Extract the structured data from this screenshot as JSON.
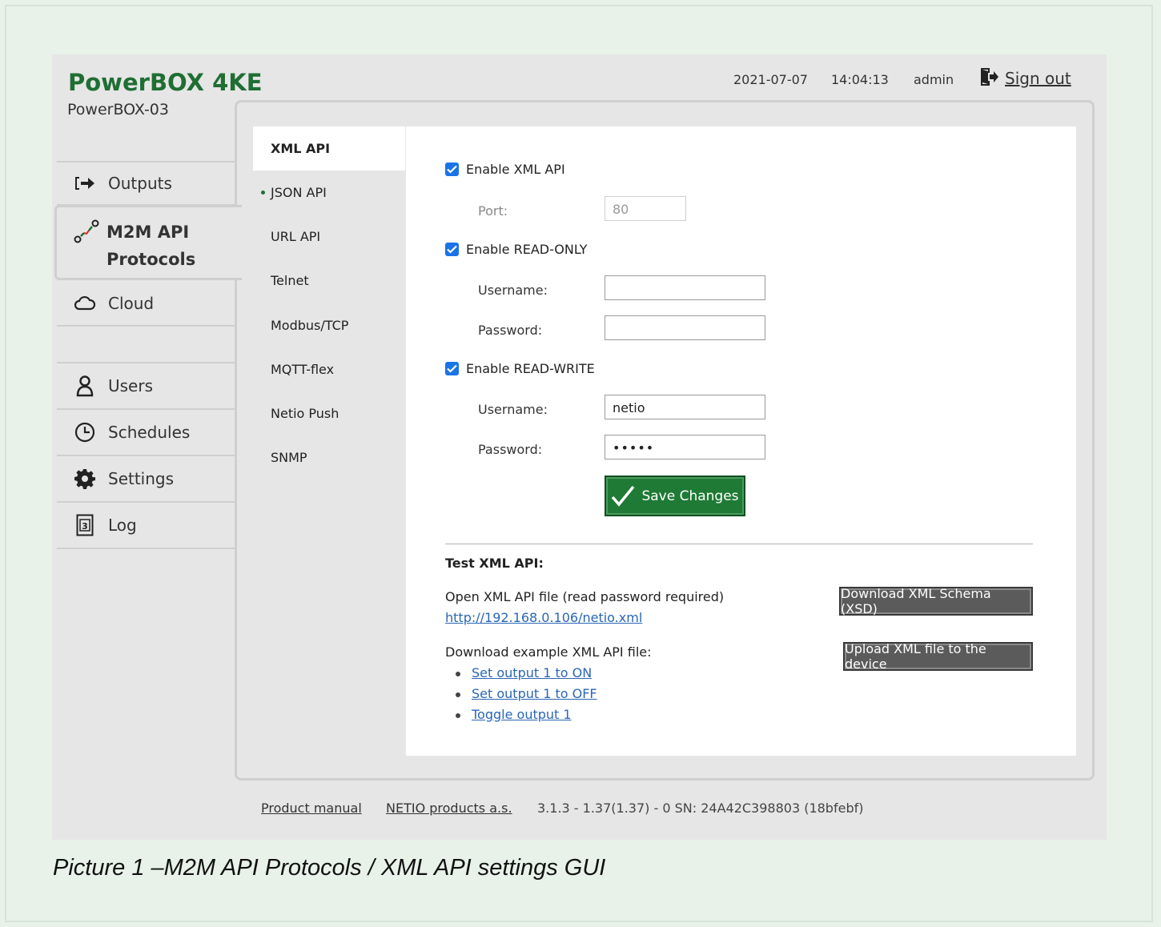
{
  "header": {
    "brand": "PowerBOX 4KE",
    "device_name": "PowerBOX-03",
    "date": "2021-07-07",
    "time": "14:04:13",
    "user": "admin",
    "signout_label": "Sign out"
  },
  "nav": {
    "items": [
      {
        "label": "Outputs",
        "icon": "output-arrow-icon"
      },
      {
        "label": "M2M API Protocols",
        "line1": "M2M API",
        "line2": "Protocols",
        "icon": "m2m-icon",
        "active": true
      },
      {
        "label": "Cloud",
        "icon": "cloud-icon"
      },
      {
        "label": "Users",
        "icon": "user-icon"
      },
      {
        "label": "Schedules",
        "icon": "clock-icon"
      },
      {
        "label": "Settings",
        "icon": "gear-icon"
      },
      {
        "label": "Log",
        "icon": "log-icon"
      }
    ]
  },
  "subnav": {
    "items": [
      "XML API",
      "JSON API",
      "URL API",
      "Telnet",
      "Modbus/TCP",
      "MQTT-flex",
      "Netio Push",
      "SNMP"
    ],
    "active": "XML API",
    "marked": "JSON API"
  },
  "form": {
    "enable_xml_label": "Enable XML API",
    "port_label": "Port:",
    "port_value": "80",
    "enable_ro_label": "Enable READ-ONLY",
    "ro_username_label": "Username:",
    "ro_username_value": "",
    "ro_password_label": "Password:",
    "ro_password_value": "",
    "enable_rw_label": "Enable READ-WRITE",
    "rw_username_label": "Username:",
    "rw_username_value": "netio",
    "rw_password_label": "Password:",
    "rw_password_value": "•••••",
    "save_label": "Save Changes"
  },
  "test": {
    "title": "Test XML API:",
    "open_text": "Open XML API file (read password required)",
    "open_link": "http://192.168.0.106/netio.xml",
    "download_example_text": "Download example XML API file:",
    "example_links": [
      "Set output 1 to ON",
      "Set output 1 to OFF",
      "Toggle output 1"
    ],
    "download_xsd_label": "Download XML Schema (XSD)",
    "upload_label": "Upload XML file to the device"
  },
  "footer": {
    "manual": "Product manual",
    "company": "NETIO products a.s.",
    "version": "3.1.3 - 1.37(1.37) - 0 SN: 24A42C398803 (18bfebf)"
  },
  "caption": "Picture 1 –M2M API Protocols / XML API settings GUI",
  "colors": {
    "brand_green": "#1f6e33",
    "save_green": "#1e7a34",
    "checkbox_blue": "#1a73e8",
    "link_blue": "#2a66b5"
  }
}
